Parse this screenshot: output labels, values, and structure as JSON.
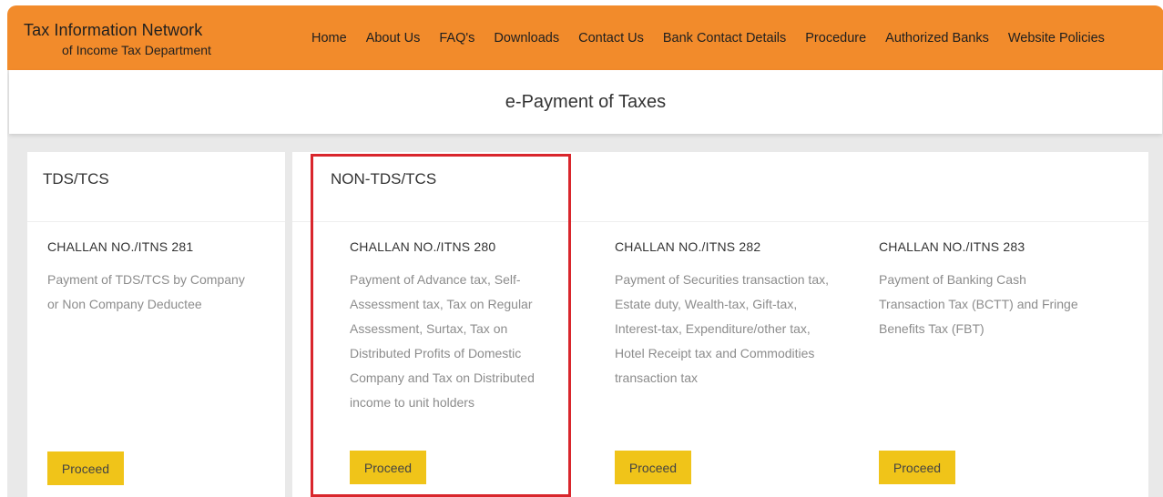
{
  "header": {
    "brand_title": "Tax Information Network",
    "brand_subtitle": "of Income Tax Department",
    "nav": [
      "Home",
      "About Us",
      "FAQ's",
      "Downloads",
      "Contact Us",
      "Bank Contact Details",
      "Procedure",
      "Authorized Banks",
      "Website Policies"
    ]
  },
  "page_title": "e-Payment of Taxes",
  "sections": {
    "tds": {
      "title": "TDS/TCS",
      "challan": "CHALLAN NO./ITNS 281",
      "desc_lines": [
        "Payment of TDS/TCS by Company",
        "or Non Company Deductee"
      ],
      "button": "Proceed"
    },
    "non_tds": {
      "title": "NON-TDS/TCS",
      "items": [
        {
          "challan": "CHALLAN NO./ITNS 280",
          "desc_lines": [
            "Payment of Advance tax, Self-",
            "Assessment tax, Tax on Regular",
            "Assessment, Surtax, Tax on",
            "Distributed Profits of Domestic",
            "Company and Tax on Distributed",
            "income to unit holders"
          ],
          "button": "Proceed"
        },
        {
          "challan": "CHALLAN NO./ITNS 282",
          "desc_lines": [
            "Payment of Securities transaction tax,",
            "Estate duty, Wealth-tax, Gift-tax,",
            "Interest-tax, Expenditure/other tax,",
            "Hotel Receipt tax and Commodities",
            "transaction tax"
          ],
          "button": "Proceed"
        },
        {
          "challan": "CHALLAN NO./ITNS 283",
          "desc_lines": [
            "Payment of Banking Cash",
            "Transaction Tax (BCTT) and Fringe",
            "Benefits Tax (FBT)"
          ],
          "button": "Proceed"
        }
      ]
    }
  },
  "colors": {
    "header_bg": "#f28b2b",
    "button_bg": "#f0c419",
    "highlight_border": "#d9262c"
  }
}
